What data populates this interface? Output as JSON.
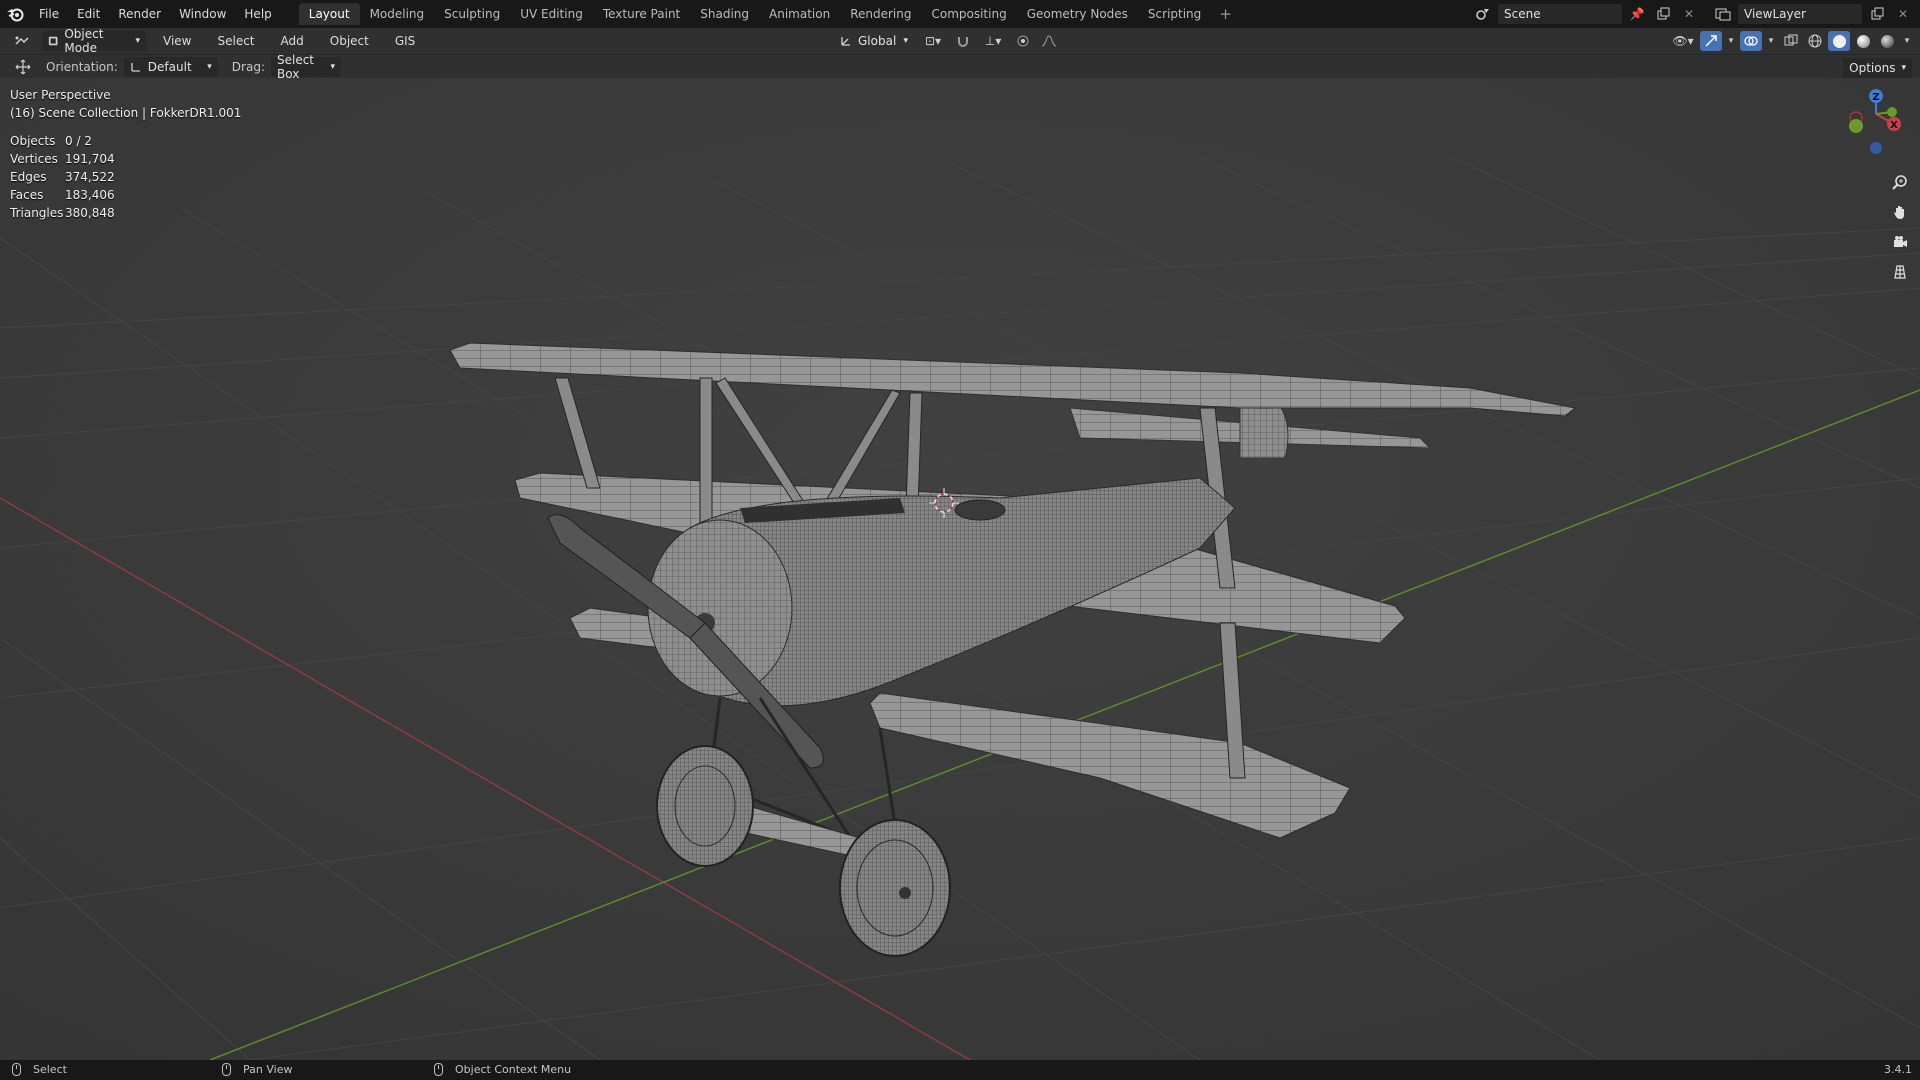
{
  "app": {
    "menu": [
      "File",
      "Edit",
      "Render",
      "Window",
      "Help"
    ],
    "workspaces": [
      "Layout",
      "Modeling",
      "Sculpting",
      "UV Editing",
      "Texture Paint",
      "Shading",
      "Animation",
      "Rendering",
      "Compositing",
      "Geometry Nodes",
      "Scripting"
    ],
    "active_workspace": "Layout",
    "scene_name": "Scene",
    "view_layer_name": "ViewLayer"
  },
  "viewport_header": {
    "mode": "Object Mode",
    "menus": [
      "View",
      "Select",
      "Add",
      "Object",
      "GIS"
    ],
    "transform_orientation": "Global",
    "options_label": "Options"
  },
  "tool_settings": {
    "orientation_label": "Orientation:",
    "orientation_value": "Default",
    "drag_label": "Drag:",
    "drag_value": "Select Box"
  },
  "viewport": {
    "view_name": "User Perspective",
    "collection_info": "(16) Scene Collection | FokkerDR1.001",
    "stats": [
      {
        "label": "Objects",
        "value": "0 / 2"
      },
      {
        "label": "Vertices",
        "value": "191,704"
      },
      {
        "label": "Edges",
        "value": "374,522"
      },
      {
        "label": "Faces",
        "value": "183,406"
      },
      {
        "label": "Triangles",
        "value": "380,848"
      }
    ],
    "gizmo_axes": {
      "z": "Z",
      "x": "X"
    }
  },
  "statusbar": {
    "select": "Select",
    "pan_view": "Pan View",
    "context_menu": "Object Context Menu",
    "version": "3.4.1"
  },
  "colors": {
    "accent": "#4772b3",
    "x_axis": "#a8313b",
    "y_axis": "#6c9a2a",
    "z_axis": "#3f7dd6"
  }
}
